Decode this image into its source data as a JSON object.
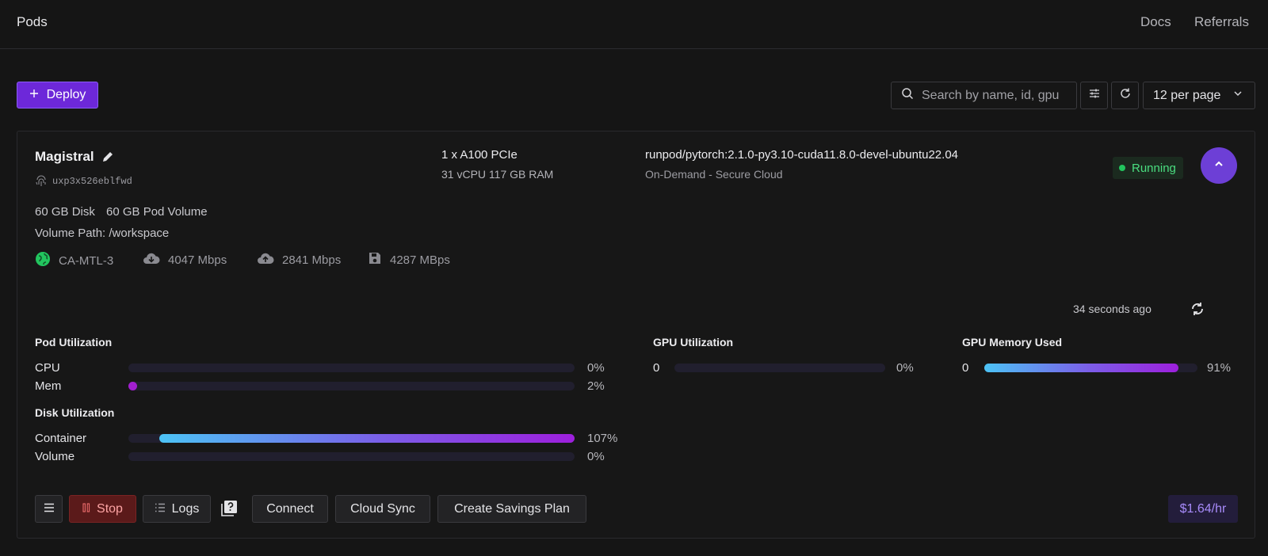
{
  "header": {
    "title": "Pods",
    "links": [
      "Docs",
      "Referrals"
    ]
  },
  "toolbar": {
    "deploy_label": "Deploy",
    "search_placeholder": "Search by name, id, gpu",
    "per_page": "12 per page"
  },
  "pod": {
    "name": "Magistral",
    "id": "uxp3x526eblfwd",
    "gpu": "1 x A100 PCIe",
    "resources": "31 vCPU 117 GB RAM",
    "image": "runpod/pytorch:2.1.0-py3.10-cuda11.8.0-devel-ubuntu22.04",
    "cloud": "On-Demand - Secure Cloud",
    "status": "Running",
    "disk": "60 GB Disk",
    "pod_volume": "60 GB Pod Volume",
    "volume_path": "Volume Path: /workspace",
    "stats": {
      "region": "CA-MTL-3",
      "download": "4047 Mbps",
      "upload": "2841 Mbps",
      "disk_speed": "4287 MBps"
    },
    "updated": "34 seconds ago",
    "price": "$1.64/hr"
  },
  "utilization": {
    "pod_title": "Pod Utilization",
    "disk_title": "Disk Utilization",
    "gpu_title": "GPU Utilization",
    "gpu_mem_title": "GPU Memory Used",
    "cpu": {
      "label": "CPU",
      "value": 0,
      "text": "0%"
    },
    "mem": {
      "label": "Mem",
      "value": 2,
      "text": "2%"
    },
    "container": {
      "label": "Container",
      "value": 107,
      "text": "107%"
    },
    "volume": {
      "label": "Volume",
      "value": 0,
      "text": "0%"
    },
    "gpu": {
      "index": "0",
      "value": 0,
      "text": "0%"
    },
    "gpu_mem": {
      "index": "0",
      "value": 91,
      "text": "91%"
    }
  },
  "actions": {
    "stop": "Stop",
    "logs": "Logs",
    "connect": "Connect",
    "cloud_sync": "Cloud Sync",
    "savings": "Create Savings Plan"
  },
  "colors": {
    "accent": "#6d28d9",
    "running": "#22c55e",
    "stop": "#5b1a1a"
  },
  "icons": [
    "plus-icon",
    "search-icon",
    "filter-icon",
    "refresh-icon",
    "chevron-down-icon",
    "pencil-icon",
    "fingerprint-icon",
    "chevron-up-icon",
    "globe-icon",
    "cloud-download-icon",
    "cloud-upload-icon",
    "save-icon",
    "sync-icon",
    "menu-icon",
    "pause-icon",
    "list-icon",
    "help-doc-icon"
  ]
}
